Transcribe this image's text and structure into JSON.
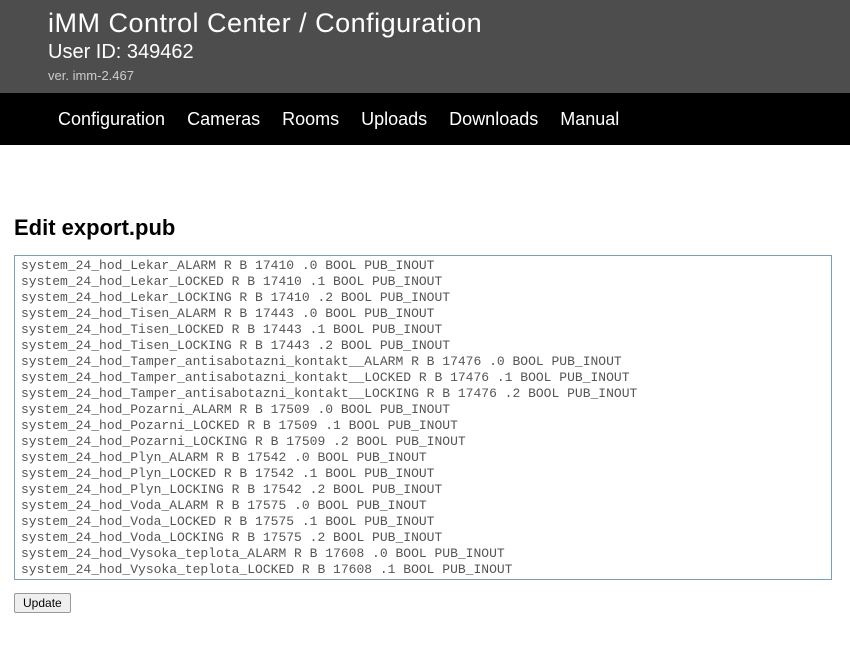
{
  "header": {
    "title": "iMM Control Center / Configuration",
    "user": "User ID: 349462",
    "version": "ver. imm-2.467"
  },
  "nav": {
    "items": [
      "Configuration",
      "Cameras",
      "Rooms",
      "Uploads",
      "Downloads",
      "Manual"
    ]
  },
  "page": {
    "heading": "Edit export.pub",
    "update_label": "Update"
  },
  "editor": {
    "content": "system_24_hod_Lekar_ALARM R B 17410 .0 BOOL PUB_INOUT\nsystem_24_hod_Lekar_LOCKED R B 17410 .1 BOOL PUB_INOUT\nsystem_24_hod_Lekar_LOCKING R B 17410 .2 BOOL PUB_INOUT\nsystem_24_hod_Tisen_ALARM R B 17443 .0 BOOL PUB_INOUT\nsystem_24_hod_Tisen_LOCKED R B 17443 .1 BOOL PUB_INOUT\nsystem_24_hod_Tisen_LOCKING R B 17443 .2 BOOL PUB_INOUT\nsystem_24_hod_Tamper_antisabotazni_kontakt__ALARM R B 17476 .0 BOOL PUB_INOUT\nsystem_24_hod_Tamper_antisabotazni_kontakt__LOCKED R B 17476 .1 BOOL PUB_INOUT\nsystem_24_hod_Tamper_antisabotazni_kontakt__LOCKING R B 17476 .2 BOOL PUB_INOUT\nsystem_24_hod_Pozarni_ALARM R B 17509 .0 BOOL PUB_INOUT\nsystem_24_hod_Pozarni_LOCKED R B 17509 .1 BOOL PUB_INOUT\nsystem_24_hod_Pozarni_LOCKING R B 17509 .2 BOOL PUB_INOUT\nsystem_24_hod_Plyn_ALARM R B 17542 .0 BOOL PUB_INOUT\nsystem_24_hod_Plyn_LOCKED R B 17542 .1 BOOL PUB_INOUT\nsystem_24_hod_Plyn_LOCKING R B 17542 .2 BOOL PUB_INOUT\nsystem_24_hod_Voda_ALARM R B 17575 .0 BOOL PUB_INOUT\nsystem_24_hod_Voda_LOCKED R B 17575 .1 BOOL PUB_INOUT\nsystem_24_hod_Voda_LOCKING R B 17575 .2 BOOL PUB_INOUT\nsystem_24_hod_Vysoka_teplota_ALARM R B 17608 .0 BOOL PUB_INOUT\nsystem_24_hod_Vysoka_teplota_LOCKED R B 17608 .1 BOOL PUB_INOUT"
  }
}
